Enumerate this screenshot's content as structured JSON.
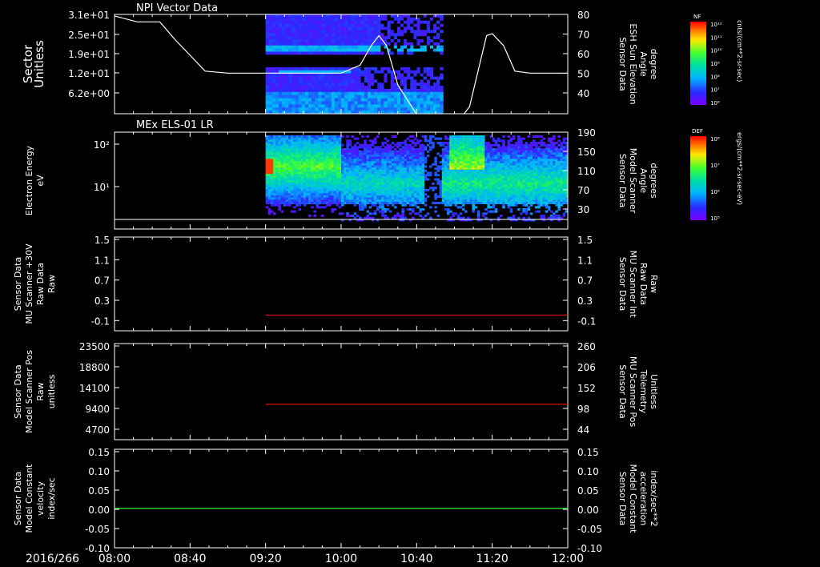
{
  "colors": {
    "background": "#000000",
    "frame": "#ffffff",
    "red_series": "#dd1111",
    "green_series": "#22dd22"
  },
  "time_axis": {
    "date_label": "2016/266",
    "ticks": [
      "08:00",
      "08:40",
      "09:20",
      "10:00",
      "10:40",
      "11:20",
      "12:00"
    ]
  },
  "chart_data": [
    {
      "type": "heatmap",
      "title": "NPI Vector Data",
      "ylabel": [
        "Sector",
        "Unitless"
      ],
      "y_ticks": [
        "3.1e+01",
        "2.5e+01",
        "1.9e+01",
        "1.2e+01",
        "6.2e+00"
      ],
      "y2label": [
        "Sensor Data",
        "ESH Sun Elevation",
        "Angle",
        "degree"
      ],
      "y2_ticks": [
        "80",
        "70",
        "60",
        "50",
        "40"
      ],
      "y2lim": [
        30,
        80
      ],
      "data_span": [
        "09:20",
        "10:54"
      ],
      "line_series": {
        "name": "",
        "x": [
          "08:00",
          "08:12",
          "08:24",
          "08:32",
          "08:48",
          "09:00",
          "09:20",
          "09:30",
          "10:00",
          "10:10",
          "10:16",
          "10:20",
          "10:24",
          "10:30",
          "10:40",
          "10:50",
          "11:00",
          "11:08",
          "11:14",
          "11:17",
          "11:20",
          "11:26",
          "11:32",
          "11:40",
          "12:00"
        ],
        "y": [
          78,
          75,
          75,
          66,
          50,
          49,
          49,
          49,
          49,
          53,
          63,
          68,
          63,
          43,
          28,
          24,
          22,
          32,
          56,
          68,
          69,
          63,
          50,
          49,
          49
        ]
      },
      "colorbar": {
        "label": "NF",
        "units": "cnts/(cm**2-sr-sec)",
        "ticks": [
          "10¹²",
          "10¹¹",
          "10¹⁰",
          "10⁹",
          "10⁸",
          "10⁷",
          "10⁶"
        ]
      }
    },
    {
      "type": "heatmap",
      "title": "MEx ELS-01 LR",
      "ylabel": [
        "Electron Energy",
        "eV"
      ],
      "y_scale": "log",
      "y_ticks": [
        "10²",
        "10¹"
      ],
      "y2label": [
        "Sensor Data",
        "Model Scanner",
        "Angle",
        "degrees"
      ],
      "y2_ticks": [
        "190",
        "150",
        "110",
        "70",
        "30"
      ],
      "data_span": [
        "09:20",
        "12:00"
      ],
      "colorbar": {
        "label": "DEF",
        "units": "ergs/(cm**2-sr-sec-eV)",
        "ticks": [
          "10⁸",
          "10⁷",
          "10⁶",
          "10⁵"
        ]
      }
    },
    {
      "type": "line",
      "ylabel": [
        "Sensor Data",
        "MU Scanner +30V",
        "Raw Data",
        "Raw"
      ],
      "y_ticks": [
        "1.5",
        "1.1",
        "0.7",
        "0.3",
        "-0.1"
      ],
      "ylim": [
        -0.3,
        1.5
      ],
      "y2label": [
        "Sensor Data",
        "MU Scanner Int",
        "Raw Data",
        "Raw"
      ],
      "y2_ticks": [
        "1.5",
        "1.1",
        "0.7",
        "0.3",
        "-0.1"
      ],
      "series": [
        {
          "name": "",
          "x": [
            "09:20",
            "12:00"
          ],
          "values": [
            0,
            0
          ]
        }
      ]
    },
    {
      "type": "line",
      "ylabel": [
        "Sensor Data",
        "Model Scanner Pos",
        "Raw",
        "unitless"
      ],
      "y_ticks": [
        "23500",
        "18800",
        "14100",
        "9400",
        "4700"
      ],
      "ylim": [
        0,
        23500
      ],
      "y2label": [
        "Sensor Data",
        "MU Scanner Pos",
        "Telemetry",
        "Unitless"
      ],
      "y2_ticks": [
        "260",
        "206",
        "152",
        "98",
        "44"
      ],
      "series": [
        {
          "name": "",
          "x": [
            "09:20",
            "12:00"
          ],
          "values": [
            8700,
            8700
          ]
        }
      ]
    },
    {
      "type": "line",
      "ylabel": [
        "Sensor Data",
        "Model Constant",
        "velocity",
        "index/sec"
      ],
      "y_ticks": [
        "0.15",
        "0.10",
        "0.05",
        "0.00",
        "-0.05",
        "-0.10"
      ],
      "ylim": [
        -0.1,
        0.15
      ],
      "y2label": [
        "Sensor Data",
        "Model Constant",
        "acceleration",
        "index/sec**2"
      ],
      "y2_ticks": [
        "0.15",
        "0.10",
        "0.05",
        "0.00",
        "-0.05",
        "-0.10"
      ],
      "series": [
        {
          "name": "",
          "x": [
            "08:00",
            "12:00"
          ],
          "values": [
            0,
            0
          ]
        }
      ]
    }
  ]
}
